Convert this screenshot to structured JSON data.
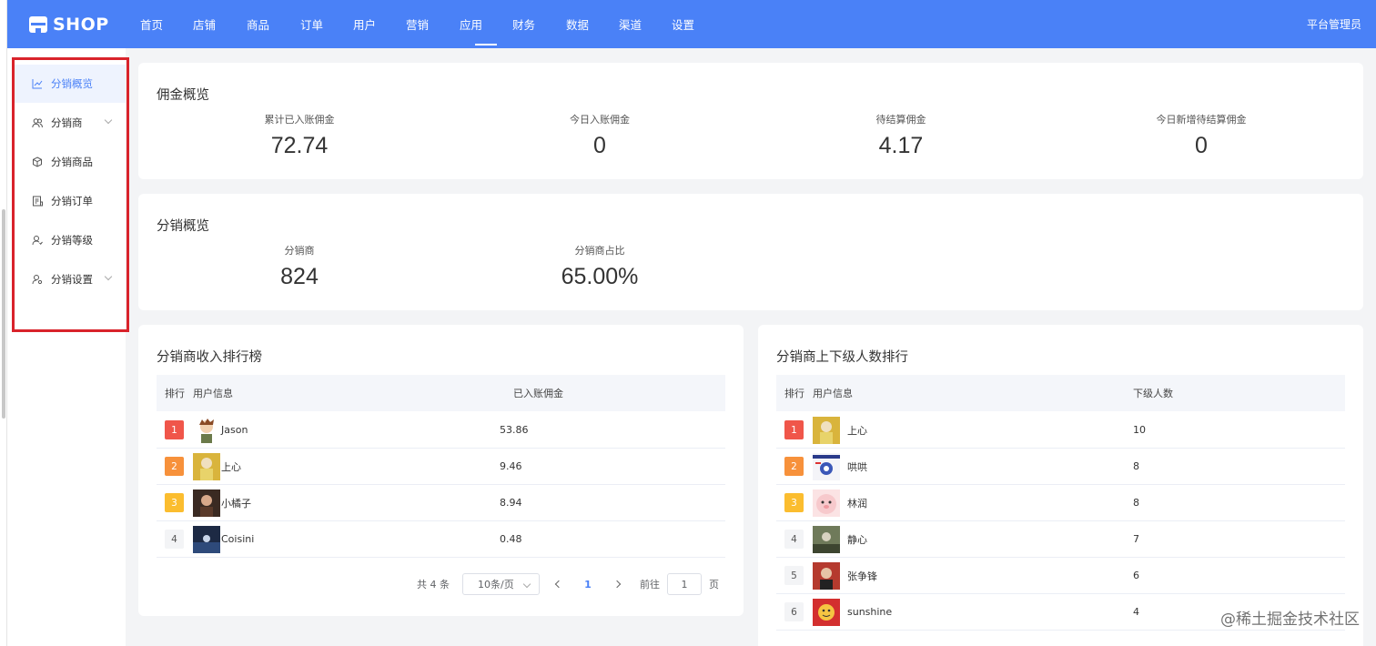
{
  "nav": {
    "brand": "SHOP",
    "items": [
      "首页",
      "店铺",
      "商品",
      "订单",
      "用户",
      "营销",
      "应用",
      "财务",
      "数据",
      "渠道",
      "设置"
    ],
    "active": "应用",
    "user": "平台管理员"
  },
  "sidebar": {
    "items": [
      {
        "label": "分销概览",
        "icon": "chart-icon",
        "active": true
      },
      {
        "label": "分销商",
        "icon": "users-icon",
        "expandable": true
      },
      {
        "label": "分销商品",
        "icon": "box-icon"
      },
      {
        "label": "分销订单",
        "icon": "order-icon"
      },
      {
        "label": "分销等级",
        "icon": "user-level-icon"
      },
      {
        "label": "分销设置",
        "icon": "user-settings-icon",
        "expandable": true
      }
    ]
  },
  "commission": {
    "title": "佣金概览",
    "stats": [
      {
        "label": "累计已入账佣金",
        "value": "72.74"
      },
      {
        "label": "今日入账佣金",
        "value": "0"
      },
      {
        "label": "待结算佣金",
        "value": "4.17"
      },
      {
        "label": "今日新增待结算佣金",
        "value": "0"
      }
    ]
  },
  "distribution": {
    "title": "分销概览",
    "stats": [
      {
        "label": "分销商",
        "value": "824"
      },
      {
        "label": "分销商占比",
        "value": "65.00%"
      }
    ]
  },
  "income_rank": {
    "title": "分销商收入排行榜",
    "headers": [
      "排行",
      "用户信息",
      "已入账佣金"
    ],
    "rows": [
      {
        "rank": "1",
        "name": "Jason",
        "value": "53.86"
      },
      {
        "rank": "2",
        "name": "上心",
        "value": "9.46"
      },
      {
        "rank": "3",
        "name": "小橘子",
        "value": "8.94"
      },
      {
        "rank": "4",
        "name": "Coisini",
        "value": "0.48"
      }
    ],
    "pager": {
      "total": "共 4 条",
      "size": "10条/页",
      "current": "1",
      "goto": "前往",
      "goto_value": "1",
      "page_unit": "页"
    }
  },
  "sub_rank": {
    "title": "分销商上下级人数排行",
    "headers": [
      "排行",
      "用户信息",
      "下级人数"
    ],
    "rows": [
      {
        "rank": "1",
        "name": "上心",
        "value": "10"
      },
      {
        "rank": "2",
        "name": "哄哄",
        "value": "8"
      },
      {
        "rank": "3",
        "name": "林润",
        "value": "8"
      },
      {
        "rank": "4",
        "name": "静心",
        "value": "7"
      },
      {
        "rank": "5",
        "name": "张争锋",
        "value": "6"
      },
      {
        "rank": "6",
        "name": "sunshine",
        "value": "4"
      }
    ]
  },
  "watermark": "@稀土掘金技术社区",
  "colors": {
    "primary": "#4a81f7",
    "highlight_outline": "#d9232b",
    "rank1": "#f0564a",
    "rank2": "#f7913b",
    "rank3": "#fbbd2f"
  }
}
